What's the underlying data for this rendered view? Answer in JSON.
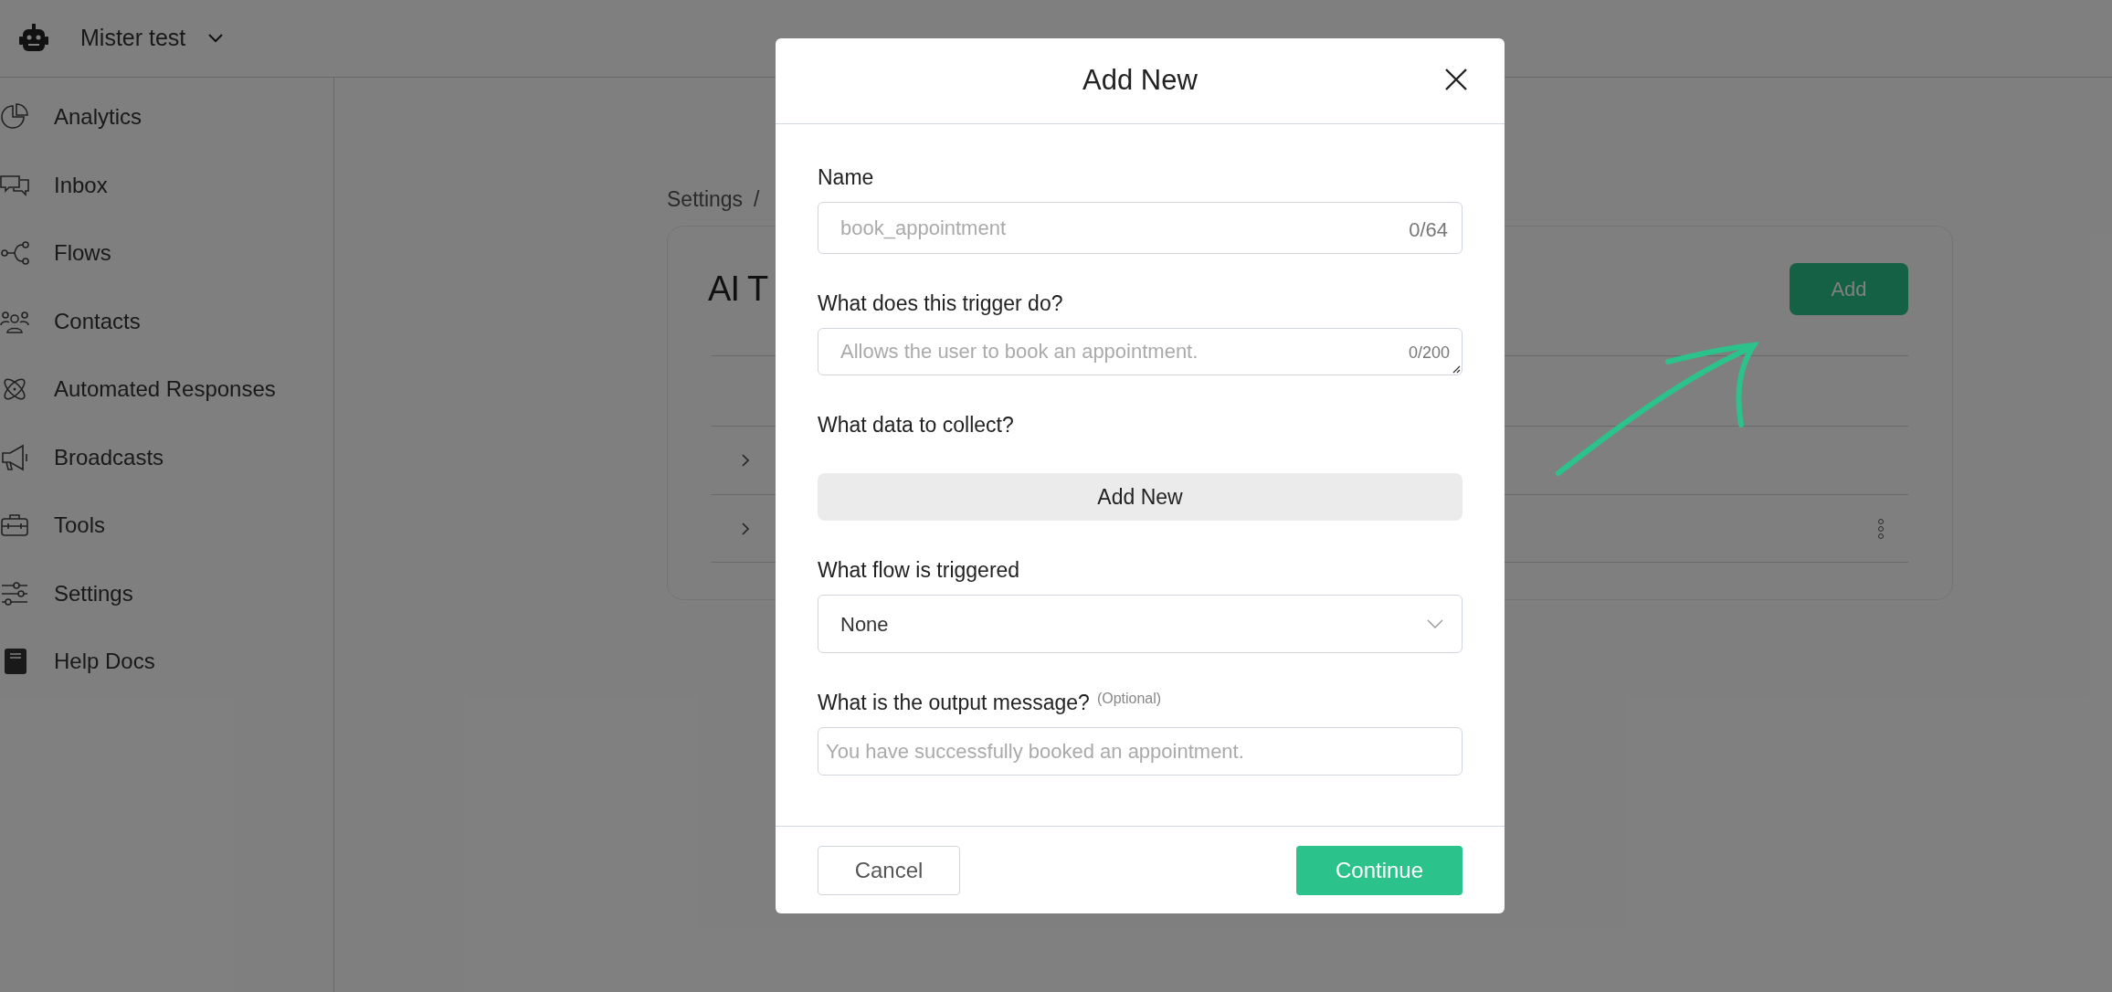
{
  "header": {
    "workspace": "Mister test"
  },
  "sidebar": {
    "items": [
      {
        "label": "Analytics"
      },
      {
        "label": "Inbox"
      },
      {
        "label": "Flows"
      },
      {
        "label": "Contacts"
      },
      {
        "label": "Automated Responses"
      },
      {
        "label": "Broadcasts"
      },
      {
        "label": "Tools"
      },
      {
        "label": "Settings"
      },
      {
        "label": "Help Docs"
      }
    ]
  },
  "breadcrumb": [
    "Settings",
    "/"
  ],
  "page": {
    "title": "AI T",
    "add_button": "Add"
  },
  "modal": {
    "title": "Add New",
    "fields": [
      {
        "kind": "text",
        "label": "Name",
        "placeholder": "book_appointment",
        "counter": "0/64"
      },
      {
        "kind": "textarea",
        "label": "What does this trigger do?",
        "placeholder": "Allows the user to book an appointment.",
        "counter": "0/200"
      },
      {
        "kind": "button",
        "label": "What data to collect?",
        "button": "Add New"
      },
      {
        "kind": "select",
        "label": "What flow is triggered",
        "value": "None"
      },
      {
        "kind": "text",
        "label": "What is the output message?",
        "hint": "(Optional)",
        "placeholder": "You have successfully booked an appointment."
      }
    ],
    "cancel": "Cancel",
    "continue": "Continue"
  }
}
